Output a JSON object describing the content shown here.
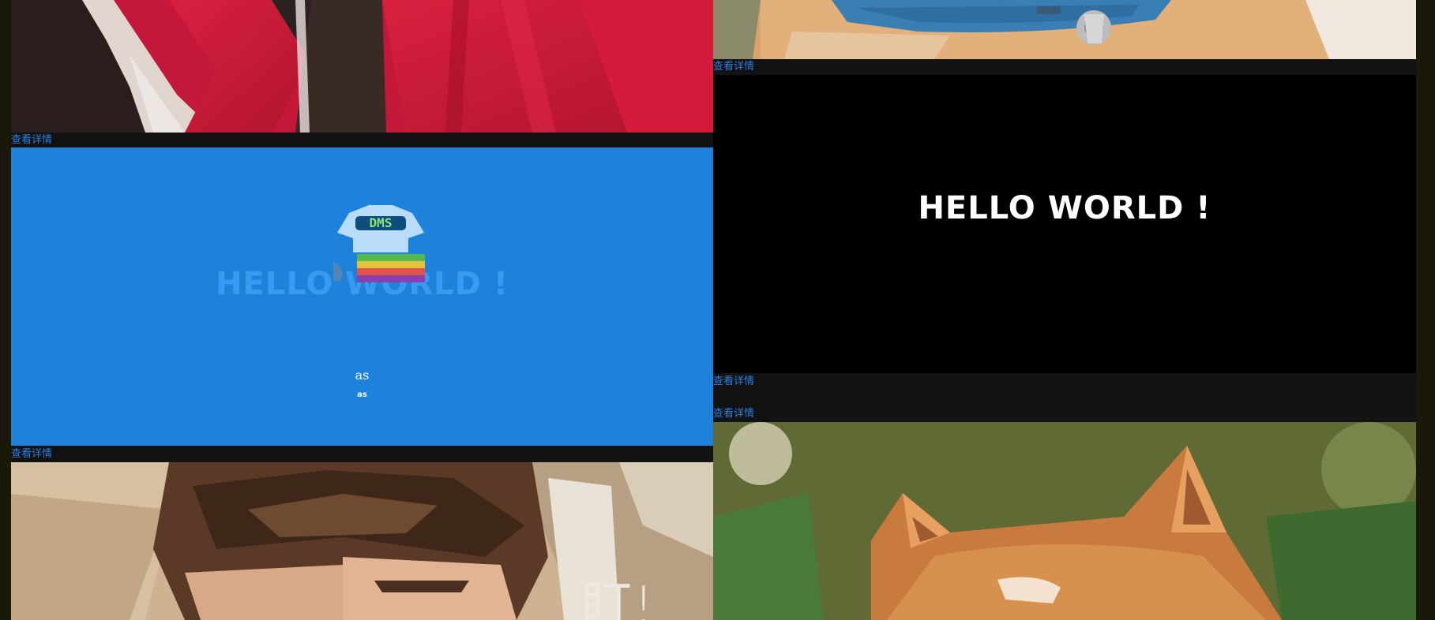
{
  "cards": {
    "left_top": {
      "link": "查看详情"
    },
    "left_blue": {
      "hello": "HELLO WORLD !",
      "logo_text": "DMS",
      "title": "as",
      "subtitle": "as",
      "link": "查看详情"
    },
    "left_bottom": {
      "overlay_text": "盯!"
    },
    "right_top": {
      "link": "查看详情"
    },
    "right_black": {
      "hello": "HELLO WORLD !",
      "link": "查看详情"
    },
    "right_bottom": {
      "link": "查看详情"
    }
  },
  "colors": {
    "page_bg": "#1c1a0c",
    "detail_bar": "#121212",
    "link": "#2a7fe0",
    "blue_card": "#1e82dc",
    "black_card": "#000000"
  }
}
